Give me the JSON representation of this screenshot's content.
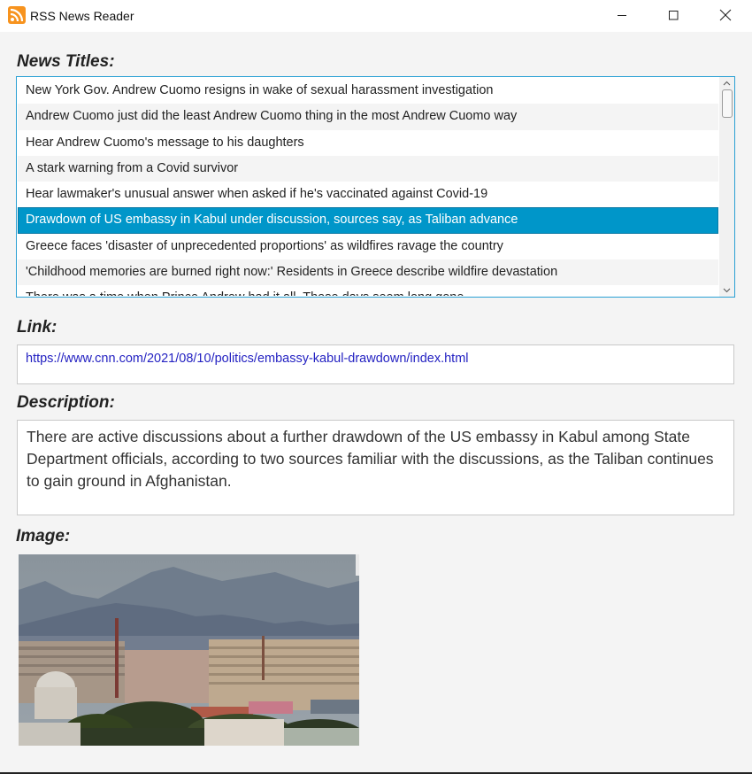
{
  "window": {
    "title": "RSS News Reader",
    "app_icon": "rss-icon"
  },
  "labels": {
    "news_titles": "News Titles:",
    "link": "Link:",
    "description": "Description:",
    "image": "Image:"
  },
  "news_titles": [
    "New York Gov. Andrew Cuomo resigns in wake of sexual harassment investigation",
    "Andrew Cuomo just did the least Andrew Cuomo thing in the most Andrew Cuomo way",
    "Hear Andrew Cuomo's message to his daughters",
    "A stark warning from a Covid survivor",
    "Hear lawmaker's unusual answer when asked if he's vaccinated against Covid-19",
    "Drawdown of US embassy in Kabul under discussion, sources say, as Taliban advance",
    "Greece faces 'disaster of unprecedented proportions' as wildfires ravage the country",
    "'Childhood memories are burned right now:' Residents in Greece describe wildfire devastation",
    "There was a time when Prince Andrew had it all. Those days seem long gone"
  ],
  "selected_index": 5,
  "link": "https://www.cnn.com/2021/08/10/politics/embassy-kabul-drawdown/index.html",
  "description": "There are active discussions about a further drawdown of the US embassy in Kabul among State Department officials, according to two sources familiar with the discussions, as the Taliban continues to gain ground in Afghanistan.",
  "colors": {
    "selection": "#0096c9",
    "list_border": "#2aa0d4",
    "link_text": "#2422c2",
    "rss_orange": "#f7931e"
  }
}
